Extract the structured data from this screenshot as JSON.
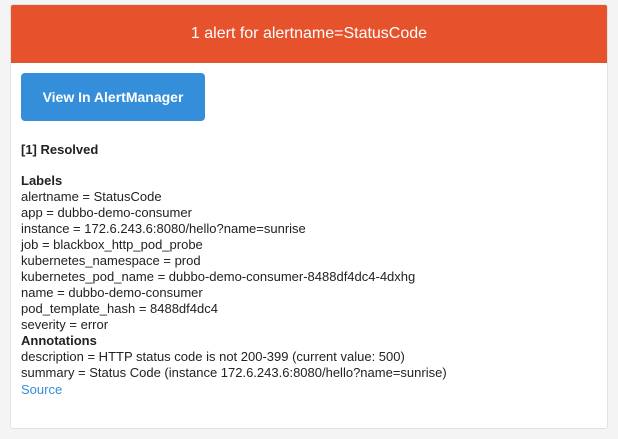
{
  "header": {
    "title": "1 alert for alertname=StatusCode"
  },
  "actions": {
    "view_button_label": "View In AlertManager"
  },
  "alert": {
    "status": "[1] Resolved",
    "labels_title": "Labels",
    "labels": [
      "alertname = StatusCode",
      "app = dubbo-demo-consumer",
      "instance = 172.6.243.6:8080/hello?name=sunrise",
      "job = blackbox_http_pod_probe",
      "kubernetes_namespace = prod",
      "kubernetes_pod_name = dubbo-demo-consumer-8488df4dc4-4dxhg",
      "name = dubbo-demo-consumer",
      "pod_template_hash = 8488df4dc4",
      "severity = error"
    ],
    "annotations_title": "Annotations",
    "annotations": [
      "description = HTTP status code is not 200-399 (current value: 500)",
      "summary = Status Code (instance 172.6.243.6:8080/hello?name=sunrise)"
    ],
    "source_label": "Source"
  },
  "colors": {
    "header_bg": "#e6522c",
    "button_bg": "#348eda",
    "link": "#348eda"
  }
}
